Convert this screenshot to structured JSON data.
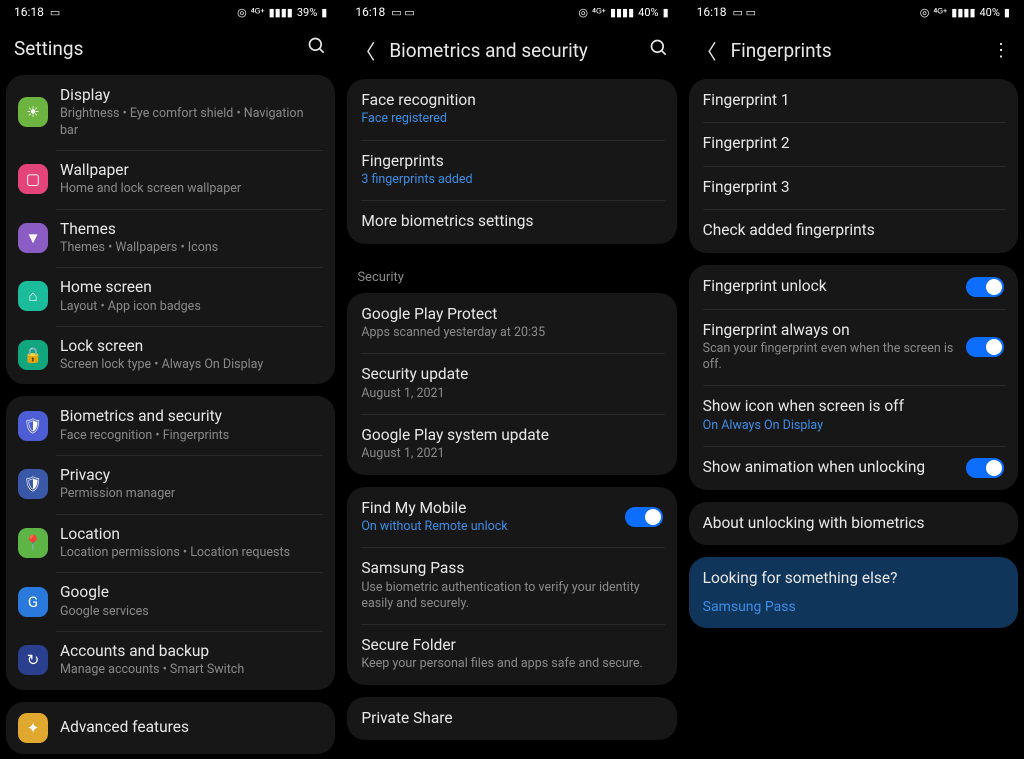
{
  "p1": {
    "status": {
      "time": "16:18",
      "battery": "39%"
    },
    "title": "Settings",
    "items": [
      {
        "title": "Display",
        "sub": "Brightness  •  Eye comfort shield  •  Navigation bar"
      },
      {
        "title": "Wallpaper",
        "sub": "Home and lock screen wallpaper"
      },
      {
        "title": "Themes",
        "sub": "Themes  •  Wallpapers  •  Icons"
      },
      {
        "title": "Home screen",
        "sub": "Layout  •  App icon badges"
      },
      {
        "title": "Lock screen",
        "sub": "Screen lock type  •  Always On Display"
      }
    ],
    "items2": [
      {
        "title": "Biometrics and security",
        "sub": "Face recognition  •  Fingerprints"
      },
      {
        "title": "Privacy",
        "sub": "Permission manager"
      },
      {
        "title": "Location",
        "sub": "Location permissions  •  Location requests"
      },
      {
        "title": "Google",
        "sub": "Google services"
      },
      {
        "title": "Accounts and backup",
        "sub": "Manage accounts  •  Smart Switch"
      }
    ],
    "items3": [
      {
        "title": "Advanced features"
      }
    ]
  },
  "p2": {
    "status": {
      "time": "16:18",
      "battery": "40%"
    },
    "title": "Biometrics and security",
    "biogroup": [
      {
        "title": "Face recognition",
        "sub": "Face registered",
        "subBlue": true
      },
      {
        "title": "Fingerprints",
        "sub": "3 fingerprints added",
        "subBlue": true
      },
      {
        "title": "More biometrics settings"
      }
    ],
    "securityHeader": "Security",
    "security": [
      {
        "title": "Google Play Protect",
        "sub": "Apps scanned yesterday at 20:35"
      },
      {
        "title": "Security update",
        "sub": "August 1, 2021"
      },
      {
        "title": "Google Play system update",
        "sub": "August 1, 2021"
      }
    ],
    "findmy": [
      {
        "title": "Find My Mobile",
        "sub": "On without Remote unlock",
        "subBlue": true,
        "toggle": true
      },
      {
        "title": "Samsung Pass",
        "sub": "Use biometric authentication to verify your identity easily and securely."
      },
      {
        "title": "Secure Folder",
        "sub": "Keep your personal files and apps safe and secure."
      }
    ],
    "private": [
      {
        "title": "Private Share"
      }
    ]
  },
  "p3": {
    "status": {
      "time": "16:18",
      "battery": "40%"
    },
    "title": "Fingerprints",
    "fps": [
      {
        "title": "Fingerprint 1"
      },
      {
        "title": "Fingerprint 2"
      },
      {
        "title": "Fingerprint 3"
      },
      {
        "title": "Check added fingerprints"
      }
    ],
    "opts": [
      {
        "title": "Fingerprint unlock",
        "toggle": true
      },
      {
        "title": "Fingerprint always on",
        "sub": "Scan your fingerprint even when the screen is off.",
        "toggle": true
      },
      {
        "title": "Show icon when screen is off",
        "sub": "On Always On Display",
        "subBlue": true
      },
      {
        "title": "Show animation when unlocking",
        "toggle": true
      }
    ],
    "about": "About unlocking with biometrics",
    "looking": "Looking for something else?",
    "lookingLink": "Samsung Pass"
  }
}
